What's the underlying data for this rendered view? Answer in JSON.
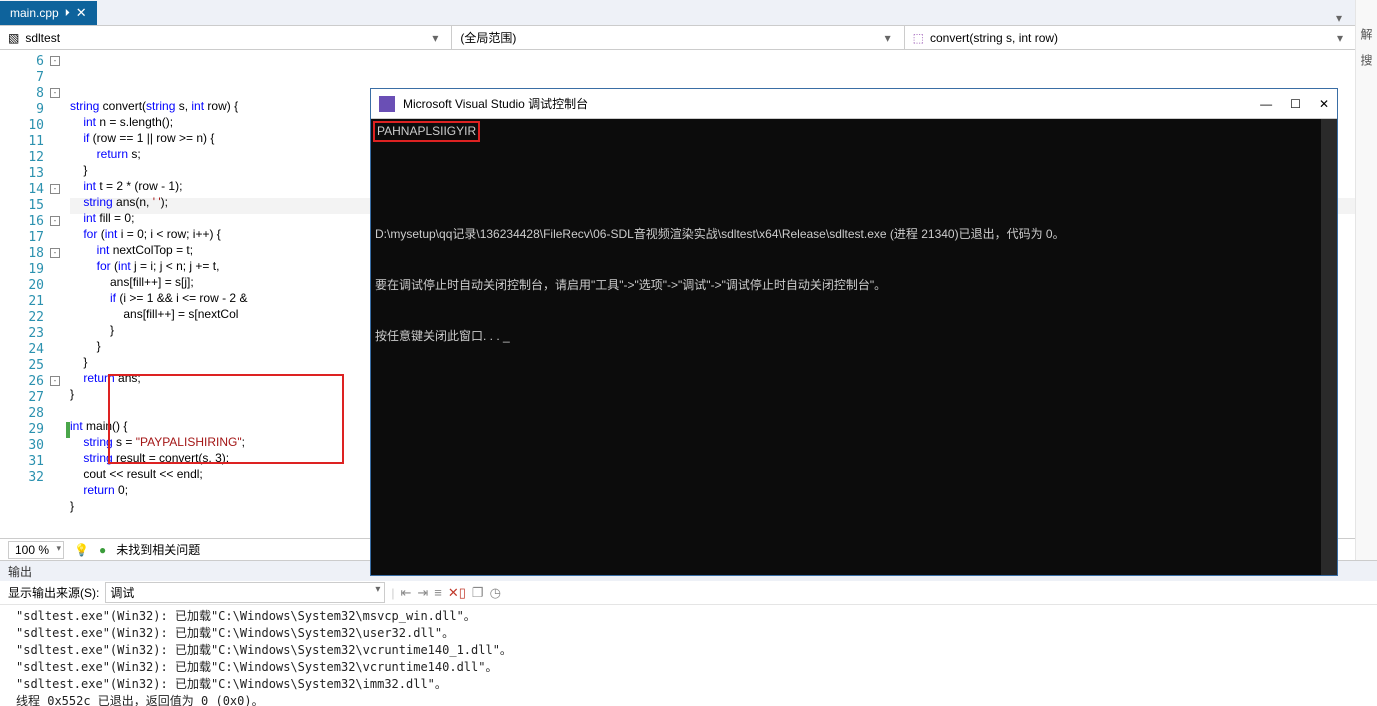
{
  "tab": {
    "name": "main.cpp",
    "pin": "⏵",
    "close": "✕"
  },
  "crumbs": {
    "left": "sdltest",
    "mid": "(全局范围)",
    "right": "convert(string s, int row)"
  },
  "lines": [
    6,
    7,
    8,
    9,
    10,
    11,
    12,
    13,
    14,
    15,
    16,
    17,
    18,
    19,
    20,
    21,
    22,
    23,
    24,
    25,
    26,
    27,
    28,
    29,
    30,
    31,
    32
  ],
  "folds": {
    "6": "-",
    "8": "-",
    "14": "-",
    "16": "-",
    "18": "-",
    "26": "-"
  },
  "code": {
    "6": [
      [
        "kw",
        "string"
      ],
      [
        "",
        ""
      ],
      [
        "fn",
        " convert"
      ],
      [
        "",
        "("
      ],
      [
        "kw",
        "string"
      ],
      [
        "",
        " s, "
      ],
      [
        "kw",
        "int"
      ],
      [
        "",
        " row) {"
      ]
    ],
    "7": [
      [
        "",
        "    "
      ],
      [
        "kw",
        "int"
      ],
      [
        "",
        " n = s."
      ],
      [
        "mem",
        "length"
      ],
      [
        "",
        "();"
      ]
    ],
    "8": [
      [
        "",
        "    "
      ],
      [
        "kw",
        "if"
      ],
      [
        "",
        " (row == "
      ],
      [
        "num",
        "1"
      ],
      [
        "",
        " || row >= n) {"
      ]
    ],
    "9": [
      [
        "",
        "        "
      ],
      [
        "kw",
        "return"
      ],
      [
        "",
        " s;"
      ]
    ],
    "10": [
      [
        "",
        "    }"
      ]
    ],
    "11": [
      [
        "",
        "    "
      ],
      [
        "kw",
        "int"
      ],
      [
        "",
        " t = "
      ],
      [
        "num",
        "2"
      ],
      [
        "",
        " * (row - "
      ],
      [
        "num",
        "1"
      ],
      [
        "",
        ");"
      ]
    ],
    "12": [
      [
        "",
        "    "
      ],
      [
        "kw",
        "string"
      ],
      [
        "",
        " ans(n, "
      ],
      [
        "str",
        "' '"
      ],
      [
        "",
        ");"
      ]
    ],
    "13": [
      [
        "",
        "    "
      ],
      [
        "kw",
        "int"
      ],
      [
        "",
        " fill = "
      ],
      [
        "num",
        "0"
      ],
      [
        "",
        ";"
      ]
    ],
    "14": [
      [
        "",
        "    "
      ],
      [
        "kw",
        "for"
      ],
      [
        "",
        " ("
      ],
      [
        "kw",
        "int"
      ],
      [
        "",
        " i = "
      ],
      [
        "num",
        "0"
      ],
      [
        "",
        "; i < row; i++) {"
      ]
    ],
    "15": [
      [
        "",
        "        "
      ],
      [
        "kw",
        "int"
      ],
      [
        "",
        " nextColTop = t;"
      ]
    ],
    "16": [
      [
        "",
        "        "
      ],
      [
        "kw",
        "for"
      ],
      [
        "",
        " ("
      ],
      [
        "kw",
        "int"
      ],
      [
        "",
        " j = i; j < n; j += t, "
      ]
    ],
    "17": [
      [
        "",
        "            ans[fill++] = s[j];"
      ]
    ],
    "18": [
      [
        "",
        "            "
      ],
      [
        "kw",
        "if"
      ],
      [
        "",
        " (i >= "
      ],
      [
        "num",
        "1"
      ],
      [
        "",
        " && i <= row - "
      ],
      [
        "num",
        "2"
      ],
      [
        "",
        " &"
      ]
    ],
    "19": [
      [
        "",
        "                ans[fill++] = s[nextCol"
      ]
    ],
    "20": [
      [
        "",
        "            }"
      ]
    ],
    "21": [
      [
        "",
        "        }"
      ]
    ],
    "22": [
      [
        "",
        "    }"
      ]
    ],
    "23": [
      [
        "",
        "    "
      ],
      [
        "kw",
        "return"
      ],
      [
        "",
        " ans;"
      ]
    ],
    "24": [
      [
        "",
        "}"
      ]
    ],
    "25": [
      [
        "",
        ""
      ]
    ],
    "26": [
      [
        "kw",
        "int"
      ],
      [
        "",
        " "
      ],
      [
        "fn",
        "main"
      ],
      [
        "",
        "() {"
      ]
    ],
    "27": [
      [
        "",
        "    "
      ],
      [
        "kw",
        "string"
      ],
      [
        "",
        " s = "
      ],
      [
        "str",
        "\"PAYPALISHIRING\""
      ],
      [
        "",
        ";"
      ]
    ],
    "28": [
      [
        "",
        "    "
      ],
      [
        "kw",
        "string"
      ],
      [
        "",
        " result = "
      ],
      [
        "fn",
        "convert"
      ],
      [
        "",
        "(s, "
      ],
      [
        "num",
        "3"
      ],
      [
        "",
        ");"
      ]
    ],
    "29": [
      [
        "",
        "    cout << result << "
      ],
      [
        "id",
        "endl"
      ],
      [
        "",
        ";"
      ]
    ],
    "30": [
      [
        "",
        "    "
      ],
      [
        "kw",
        "return"
      ],
      [
        "",
        " "
      ],
      [
        "num",
        "0"
      ],
      [
        "",
        ";"
      ]
    ],
    "31": [
      [
        "",
        "}"
      ]
    ],
    "32": [
      [
        "",
        ""
      ]
    ]
  },
  "zoom": {
    "pct": "100 %",
    "issues": "未找到相关问题"
  },
  "console": {
    "title": "Microsoft Visual Studio 调试控制台",
    "out": "PAHNAPLSIIGYIR",
    "line2": "D:\\mysetup\\qq记录\\136234428\\FileRecv\\06-SDL音视频渲染实战\\sdltest\\x64\\Release\\sdltest.exe (进程 21340)已退出，代码为 0。",
    "line3": "要在调试停止时自动关闭控制台，请启用\"工具\"->\"选项\"->\"调试\"->\"调试停止时自动关闭控制台\"。",
    "line4": "按任意键关闭此窗口. . . _"
  },
  "output": {
    "title": "输出",
    "srclbl": "显示输出来源(S):",
    "src": "调试",
    "lines": [
      "\"sdltest.exe\"(Win32): 已加载\"C:\\Windows\\System32\\msvcp_win.dll\"。",
      "\"sdltest.exe\"(Win32): 已加载\"C:\\Windows\\System32\\user32.dll\"。",
      "\"sdltest.exe\"(Win32): 已加载\"C:\\Windows\\System32\\vcruntime140_1.dll\"。",
      "\"sdltest.exe\"(Win32): 已加载\"C:\\Windows\\System32\\vcruntime140.dll\"。",
      "\"sdltest.exe\"(Win32): 已加载\"C:\\Windows\\System32\\imm32.dll\"。",
      "线程 0x552c 已退出，返回值为 0 (0x0)。"
    ]
  },
  "side": {
    "a": "解",
    "b": "搜"
  }
}
